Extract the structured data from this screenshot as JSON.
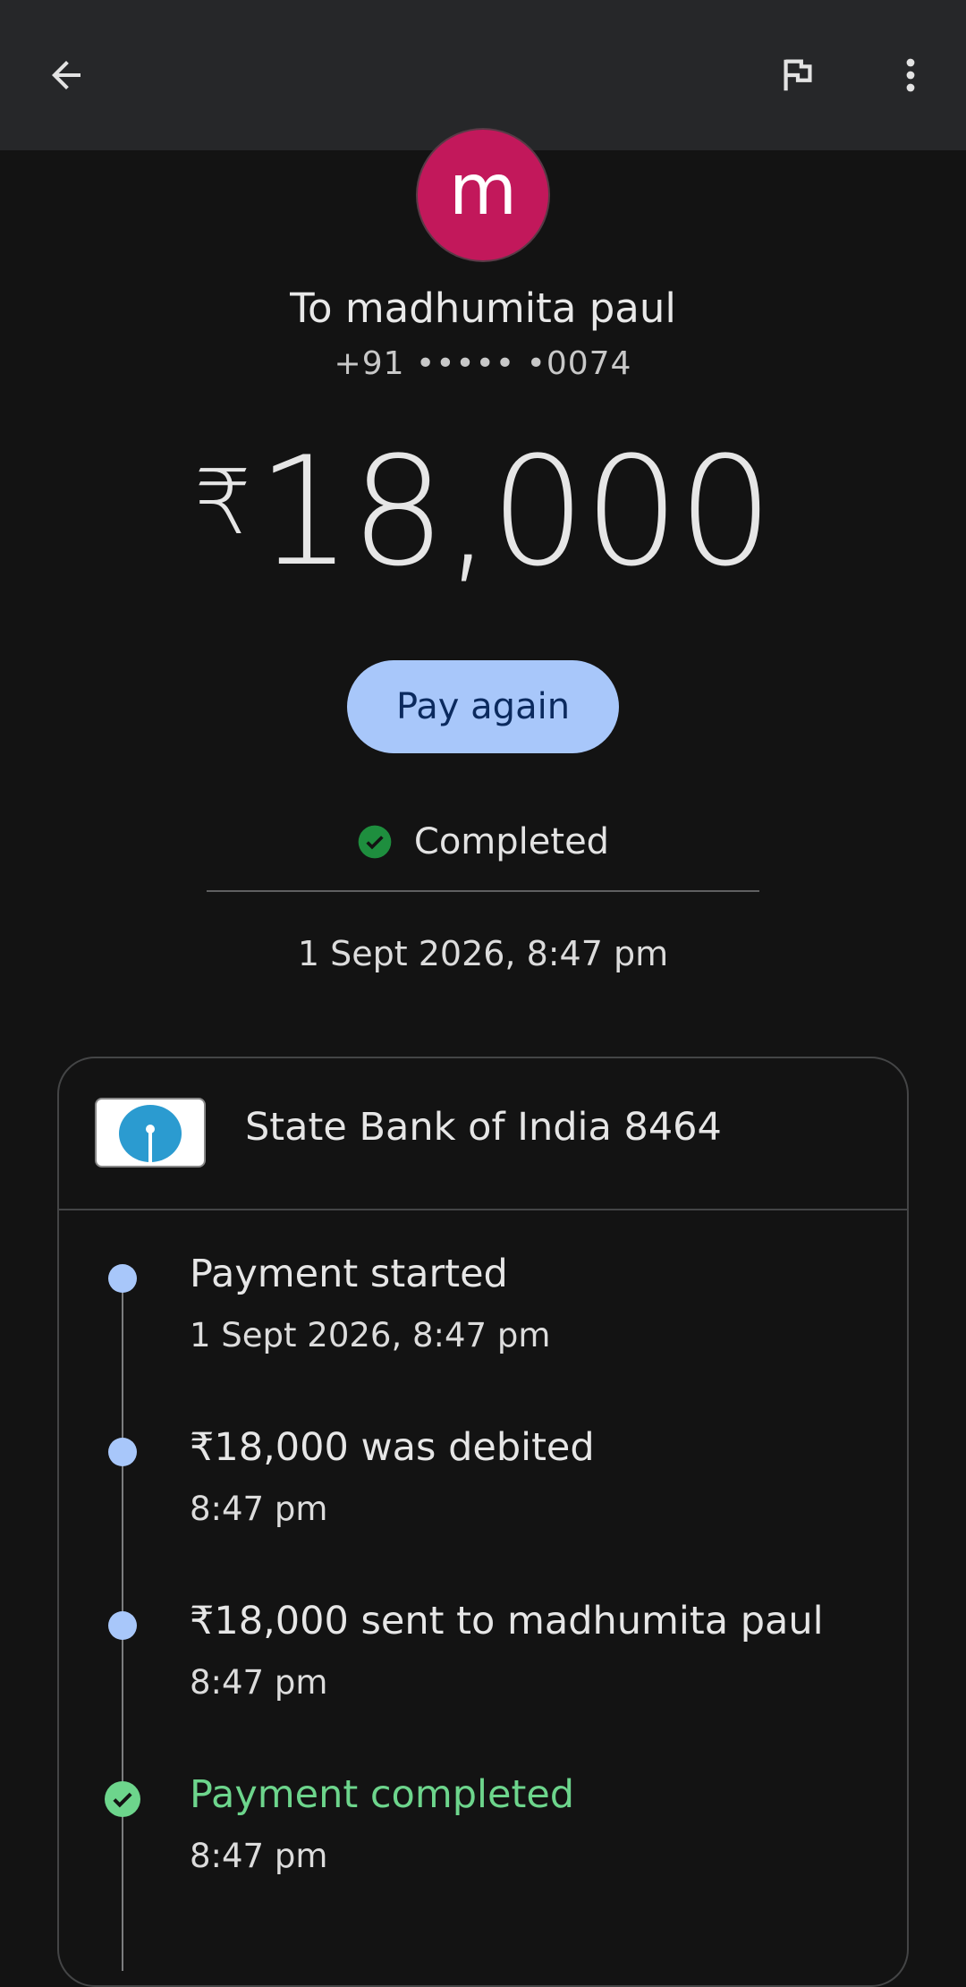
{
  "header": {
    "back_icon": "arrow-back-icon",
    "flag_icon": "flag-icon",
    "more_icon": "more-vert-icon"
  },
  "recipient": {
    "avatar_letter": "m",
    "avatar_color": "#c2185b",
    "to_name": "To madhumita paul",
    "phone": "+91 ••••• •0074"
  },
  "amount": {
    "currency": "₹",
    "value": "18,000"
  },
  "actions": {
    "pay_again_label": "Pay again"
  },
  "status": {
    "label": "Completed",
    "color": "#1e8e3e"
  },
  "transaction": {
    "datetime": "1 Sept 2026, 8:47 pm"
  },
  "bank": {
    "name": "State Bank of India 8464",
    "logo_icon": "sbi-logo"
  },
  "timeline": [
    {
      "title": "Payment started",
      "time": "1 Sept 2026, 8:47 pm"
    },
    {
      "title": "₹18,000 was debited",
      "time": "8:47 pm"
    },
    {
      "title": "₹18,000 sent to madhumita paul",
      "time": "8:47 pm"
    },
    {
      "title": "Payment completed",
      "time": "8:47 pm"
    }
  ]
}
